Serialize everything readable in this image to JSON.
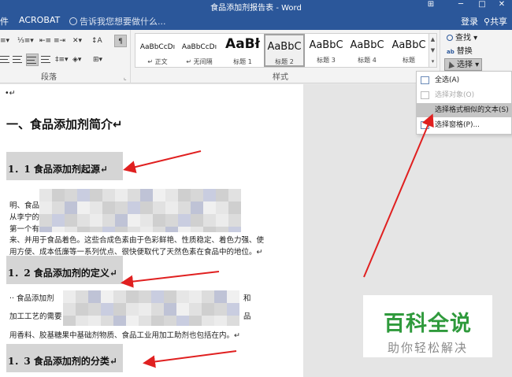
{
  "window": {
    "title": "食品添加剂报告表 - Word",
    "controls": [
      "⊞",
      "─",
      "□",
      "✕"
    ]
  },
  "tabs": {
    "left_partial": "件",
    "acrobat": "ACROBAT",
    "tell_me": "告诉我您想要做什么...",
    "login": "登录",
    "share": "共享"
  },
  "ribbon": {
    "paragraph": {
      "label": "段落",
      "launcher": "⌞"
    },
    "styles": {
      "label": "样式",
      "items": [
        {
          "preview": "AaBbCcDı",
          "name": "↵ 正文"
        },
        {
          "preview": "AaBbCcDı",
          "name": "↵ 无间隔"
        },
        {
          "preview": "AaBł",
          "name": "标题 1"
        },
        {
          "preview": "AaBbC",
          "name": "标题 2"
        },
        {
          "preview": "AaBbC",
          "name": "标题 3"
        },
        {
          "preview": "AaBbC",
          "name": "标题 4"
        },
        {
          "preview": "AaBbC",
          "name": "标题"
        }
      ],
      "scroll": [
        "▲",
        "▼",
        "▾"
      ]
    },
    "editing": {
      "find": "查找 ▾",
      "replace": "替换",
      "select": "选择 ▾"
    }
  },
  "select_menu": {
    "items": [
      {
        "label": "全选(A)",
        "enabled": true
      },
      {
        "label": "选择对象(O)",
        "enabled": false
      },
      {
        "label": "选择格式相似的文本(S)",
        "enabled": true,
        "highlighted": true
      },
      {
        "label": "选择窗格(P)...",
        "enabled": true
      }
    ]
  },
  "document": {
    "top_bullet": "•↵",
    "h1": "一、食品添加剂简介↵",
    "headings": [
      "1．1 食品添加剂起源↵",
      "1．2 食品添加剂的定义↵",
      "1．3 食品添加剂的分类↵"
    ],
    "p1": {
      "line1": "明、食品",
      "line2": "从李宁的",
      "line3": "第一个有",
      "line4": "来、并用于食品着色。这些合成色素由于色彩鲜艳、性质稳定、着色力强、使",
      "line5": "用方便、成本低廉等一系列优点、很快便取代了天然色素在食品中的地位。↵"
    },
    "p2": {
      "line1": "·· 食品添加剂",
      "line1_end": "和",
      "line2": "加工工艺的需要",
      "line2_end": "品",
      "line3": "用香料、胶基糖果中基础剂物质、食品工业用加工助剂也包括在内。↵"
    }
  },
  "watermark": {
    "title": "百科全说",
    "subtitle": "助你轻松解决"
  },
  "colors": {
    "word_blue": "#2b579a",
    "arrow_red": "#e02020",
    "watermark_green": "#2f9a3c"
  }
}
